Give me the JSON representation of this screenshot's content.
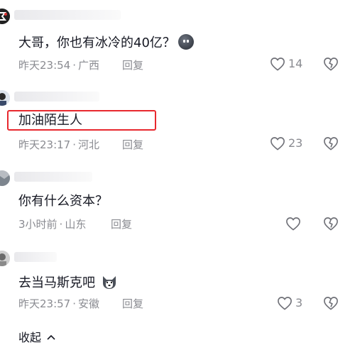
{
  "comments": [
    {
      "text": "大哥，你也有冰冷的40亿？",
      "emoji": "moon-face-emoji",
      "time": "昨天23:54",
      "location": "广西",
      "reply": "回复",
      "likes": "14"
    },
    {
      "text": "加油陌生人",
      "time": "昨天23:17",
      "location": "河北",
      "reply": "回复",
      "likes": "23"
    },
    {
      "text": "你有什么资本？",
      "time": "3小时前",
      "location": "山东",
      "reply": "回复",
      "likes": ""
    },
    {
      "text": "去当马斯克吧",
      "emoji": "husky-emoji",
      "time": "昨天23:57",
      "location": "安徽",
      "reply": "回复",
      "likes": "3"
    }
  ],
  "separator": "·",
  "collapse_label": "收起",
  "colors": {
    "highlight": "#e8282e",
    "meta": "#8a8b91",
    "text": "#161823"
  },
  "icons": {
    "like": "heart-outline-icon",
    "dislike": "broken-heart-icon",
    "collapse": "chevron-up-icon"
  }
}
